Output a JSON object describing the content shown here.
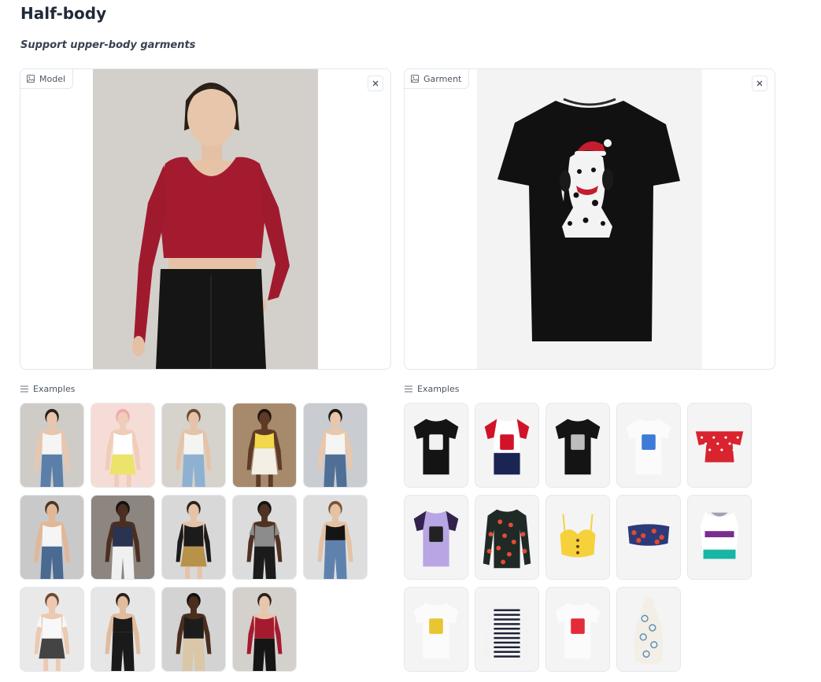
{
  "header": {
    "title": "Half-body",
    "subtitle": "Support upper-body garments"
  },
  "model_panel": {
    "label": "Model",
    "label_icon": "image-icon",
    "close_icon": "close-icon"
  },
  "garment_panel": {
    "label": "Garment",
    "label_icon": "image-icon",
    "close_icon": "close-icon"
  },
  "model_examples": {
    "label": "Examples",
    "icon": "list-icon",
    "items": [
      {
        "bg": "#cfccc8",
        "skin": "#e8c6ad",
        "hair": "#2a211c",
        "top": "#f5f5f3",
        "bottom": "#5b7fa8",
        "top_style": "tank"
      },
      {
        "bg": "#f6dcd6",
        "skin": "#f0cdb8",
        "hair": "#f0a7b2",
        "top": "#ffffff",
        "bottom": "#ece36a",
        "top_style": "tank",
        "bottom_style": "skirt"
      },
      {
        "bg": "#d6d2cc",
        "skin": "#e6c2a8",
        "hair": "#6b4a33",
        "top": "#f4f4f2",
        "bottom": "#8fb1d1",
        "top_style": "tank"
      },
      {
        "bg": "#a78a6c",
        "skin": "#5e3b26",
        "hair": "#1c1512",
        "top": "#f2d84a",
        "bottom": "#f3efe4",
        "top_style": "crop",
        "bottom_style": "skirt"
      },
      {
        "bg": "#c9ccd0",
        "skin": "#e8c7ac",
        "hair": "#1f1a17",
        "top": "#f5f5f3",
        "bottom": "#4f6f96",
        "top_style": "tank"
      },
      {
        "bg": "#c9c9c9",
        "skin": "#e1b798",
        "hair": "#4a3424",
        "top": "#f5f5f5",
        "bottom": "#4a6a92",
        "top_style": "tank"
      },
      {
        "bg": "#8d8680",
        "skin": "#4a2f20",
        "hair": "#141111",
        "top": "#2a3350",
        "bottom": "#f0f0f0",
        "top_style": "tank"
      },
      {
        "bg": "#d8d8d8",
        "skin": "#e6c3a7",
        "hair": "#2b211b",
        "top": "#1b1b1b",
        "bottom": "#b8924a",
        "top_style": "long",
        "bottom_style": "skirt"
      },
      {
        "bg": "#dcdcdc",
        "skin": "#4f3222",
        "hair": "#161212",
        "top": "#8c8c8c",
        "bottom": "#1b1b1b",
        "top_style": "tee"
      },
      {
        "bg": "#dedede",
        "skin": "#e5c2a4",
        "hair": "#7a5436",
        "top": "#151515",
        "bottom": "#5f82ad",
        "top_style": "crop"
      },
      {
        "bg": "#e9e9e9",
        "skin": "#ecc9b0",
        "hair": "#6b4a30",
        "top": "#f8f8f8",
        "bottom": "#444444",
        "top_style": "tee",
        "bottom_style": "skirt"
      },
      {
        "bg": "#e6e6e6",
        "skin": "#e0bb9d",
        "hair": "#2a1f18",
        "top": "#1a1a1a",
        "bottom": "#1a1a1a",
        "top_style": "crop"
      },
      {
        "bg": "#d3d3d3",
        "skin": "#4a2d1d",
        "hair": "#141010",
        "top": "#1c1c1c",
        "bottom": "#d9c7a7",
        "top_style": "tank"
      },
      {
        "bg": "#d4d1cd",
        "skin": "#e8c6ab",
        "hair": "#2a2019",
        "top": "#a41b30",
        "bottom": "#151515",
        "top_style": "long"
      }
    ]
  },
  "garment_examples": {
    "label": "Examples",
    "icon": "list-icon",
    "items": [
      {
        "kind": "tee",
        "color": "#141414",
        "accent": "#f2f2f2",
        "sleeve": "#141414"
      },
      {
        "kind": "tee",
        "color": "#ffffff",
        "accent": "#d1132a",
        "sleeve": "#d1132a",
        "band": "#1a2553"
      },
      {
        "kind": "tee",
        "color": "#141414",
        "accent": "#bdbdbd",
        "sleeve": "#141414"
      },
      {
        "kind": "tee",
        "color": "#fbfbfb",
        "accent": "#3d7bd6",
        "sleeve": "#fbfbfb",
        "trim": "#2456b8"
      },
      {
        "kind": "offshoulder",
        "color": "#d9232e",
        "accent": "#ffffff"
      },
      {
        "kind": "tee",
        "color": "#b8a5e3",
        "accent": "#222222",
        "sleeve": "#33224d"
      },
      {
        "kind": "longsleeve",
        "color": "#1f2a27",
        "accent": "#e84b2f"
      },
      {
        "kind": "bra",
        "color": "#f5d23c",
        "accent": "#6b3a1d"
      },
      {
        "kind": "tube",
        "color": "#2c3a7a",
        "accent": "#e24a2a"
      },
      {
        "kind": "sportsbra",
        "color": "#ffffff",
        "accent": "#7a2d8f",
        "band": "#19b5a5"
      },
      {
        "kind": "tee",
        "color": "#fbfbfb",
        "accent": "#e8c531",
        "sleeve": "#fbfbfb"
      },
      {
        "kind": "longsleeve",
        "color": "#f3f3f3",
        "accent": "#1c1f33",
        "stripes": true
      },
      {
        "kind": "tee",
        "color": "#fbfbfb",
        "accent": "#e42b3a",
        "sleeve": "#fbfbfb"
      },
      {
        "kind": "halter",
        "color": "#f3efe6",
        "accent": "#5a8fb8"
      }
    ]
  },
  "colors": {
    "model_top": "#a41b30",
    "model_pants": "#151515",
    "model_skin": "#e8c6ab",
    "model_hair": "#2a2019",
    "garment_shirt": "#111111",
    "garment_print": "#f5f5f5",
    "hat_red": "#c41e2e"
  }
}
